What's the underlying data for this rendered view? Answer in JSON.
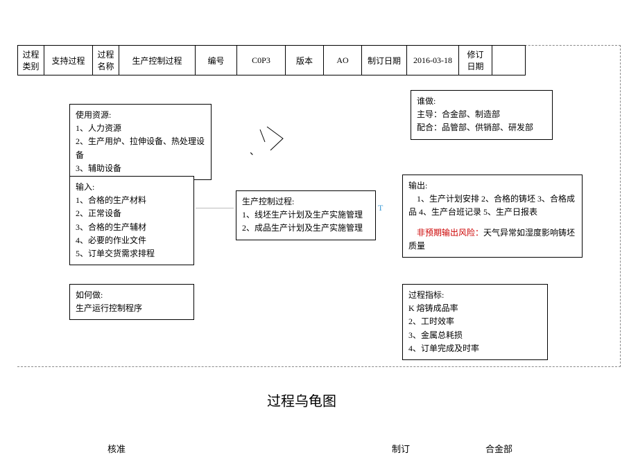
{
  "header": {
    "c1_label": "过程类别",
    "c1_value": "支持过程",
    "c2_label": "过程名称",
    "c2_value": "生产控制过程",
    "c3_label": "编号",
    "c3_value": "C0P3",
    "c4_label": "版本",
    "c4_value": "AO",
    "c5_label": "制订日期",
    "c5_value": "2016-03-18",
    "c6_label": "修订日期",
    "c6_value": ""
  },
  "resources": {
    "title": "使用资源:",
    "l1": "1、人力资源",
    "l2": "2、生产用炉、拉伸设备、热处理设备",
    "l3": "3、辅助设备"
  },
  "who": {
    "title": "谁做:",
    "l1": "主导：合金部、制造部",
    "l2": "配合：品管部、供销部、研发部"
  },
  "input": {
    "title": "输入:",
    "l1": "1、合格的生产材料",
    "l2": "2、正常设备",
    "l3": "3、合格的生产辅材",
    "l4": "4、必要的作业文件",
    "l5": "5、订单交货需求排程"
  },
  "process": {
    "title": "生产控制过程:",
    "l1": "1、线坯生产计划及生产实施管理",
    "l2": "2、成品生产计划及生产实施管理"
  },
  "output": {
    "title": "输出:",
    "l1": "　1、生产计划安排 2、合格的铸坯 3、合格成品 4、生产台班记录 5、生产日报表",
    "risk_label": "　非预期输出风险：",
    "risk_text": "天气异常如湿度影响铸坯质量"
  },
  "how": {
    "title": "如何做:",
    "l1": "生产运行控制程序"
  },
  "kpi": {
    "title": "过程指标:",
    "l1": "K 熔铸成品率",
    "l2": "2、工时效率",
    "l3": "3、金属总耗损",
    "l4": "4、订单完成及时率"
  },
  "diagram_title": "过程乌龟图",
  "footer": {
    "approve": "核准",
    "draft": "制订",
    "dept": "合金部"
  },
  "marks": {
    "t": "T",
    "comma": "、"
  }
}
